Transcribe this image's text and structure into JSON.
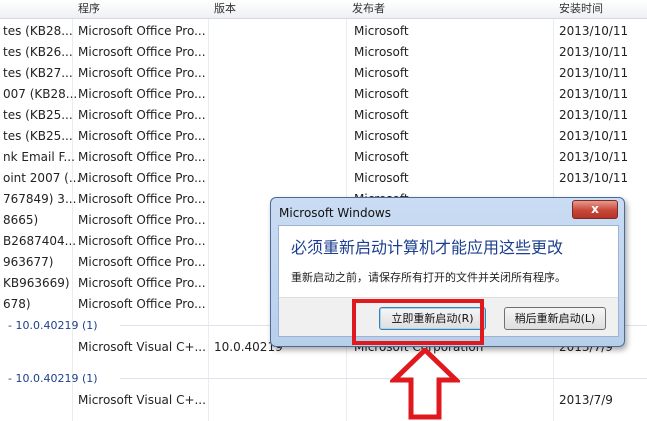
{
  "columns": [
    "程序",
    "版本",
    "发布者",
    "安装时间"
  ],
  "rows": [
    {
      "name": "tes (KB28...",
      "program": "Microsoft Office Pro...",
      "version": "",
      "publisher": "Microsoft",
      "date": "2013/10/11"
    },
    {
      "name": "tes (KB26...",
      "program": "Microsoft Office Pro...",
      "version": "",
      "publisher": "Microsoft",
      "date": "2013/10/11"
    },
    {
      "name": "tes (KB27...",
      "program": "Microsoft Office Pro...",
      "version": "",
      "publisher": "Microsoft",
      "date": "2013/10/11"
    },
    {
      "name": "007 (KB28...",
      "program": "Microsoft Office Pro...",
      "version": "",
      "publisher": "Microsoft",
      "date": "2013/10/11"
    },
    {
      "name": "tes (KB25...",
      "program": "Microsoft Office Pro...",
      "version": "",
      "publisher": "Microsoft",
      "date": "2013/10/11"
    },
    {
      "name": "tes (KB25...",
      "program": "Microsoft Office Pro...",
      "version": "",
      "publisher": "Microsoft",
      "date": "2013/10/11"
    },
    {
      "name": "nk Email F...",
      "program": "Microsoft Office Pro...",
      "version": "",
      "publisher": "Microsoft",
      "date": "2013/10/11"
    },
    {
      "name": "oint 2007 (...",
      "program": "Microsoft Office Pro...",
      "version": "",
      "publisher": "Microsoft",
      "date": "2013/10/11"
    },
    {
      "name": "767849) 3...",
      "program": "Microsoft Office Pro...",
      "version": "",
      "publisher": "Microsoft",
      "date": ""
    },
    {
      "name": "8665)",
      "program": "Microsoft Office Pro...",
      "version": "",
      "publisher": "",
      "date": ""
    },
    {
      "name": "B2687404...",
      "program": "Microsoft Office Pro...",
      "version": "",
      "publisher": "",
      "date": ""
    },
    {
      "name": "963677)",
      "program": "Microsoft Office Pro...",
      "version": "",
      "publisher": "",
      "date": ""
    },
    {
      "name": "KB963669)",
      "program": "Microsoft Office Pro...",
      "version": "",
      "publisher": "",
      "date": ""
    },
    {
      "name": "678)",
      "program": "Microsoft Office Pro...",
      "version": "",
      "publisher": "",
      "date": ""
    }
  ],
  "groups": [
    {
      "label": "- 10.0.40219 (1)"
    },
    {
      "label": "- 10.0.40219 (1)"
    }
  ],
  "group_rows": [
    {
      "program": "Microsoft Visual C+...",
      "version": "10.0.40219",
      "publisher": "Microsoft Corporation",
      "date": "2013/7/9"
    },
    {
      "program": "Microsoft Visual C+...",
      "version": "",
      "publisher": "",
      "date": "2013/7/9"
    }
  ],
  "dialog": {
    "title": "Microsoft Windows",
    "close": "x",
    "heading": "必须重新启动计算机才能应用这些更改",
    "message": "重新启动之前，请保存所有打开的文件并关闭所有程序。",
    "btn_now": "立即重新启动(R)",
    "btn_later": "稍后重新启动(L)"
  },
  "colors": {
    "highlight": "#e0191e",
    "accent": "#1d3f8f"
  }
}
